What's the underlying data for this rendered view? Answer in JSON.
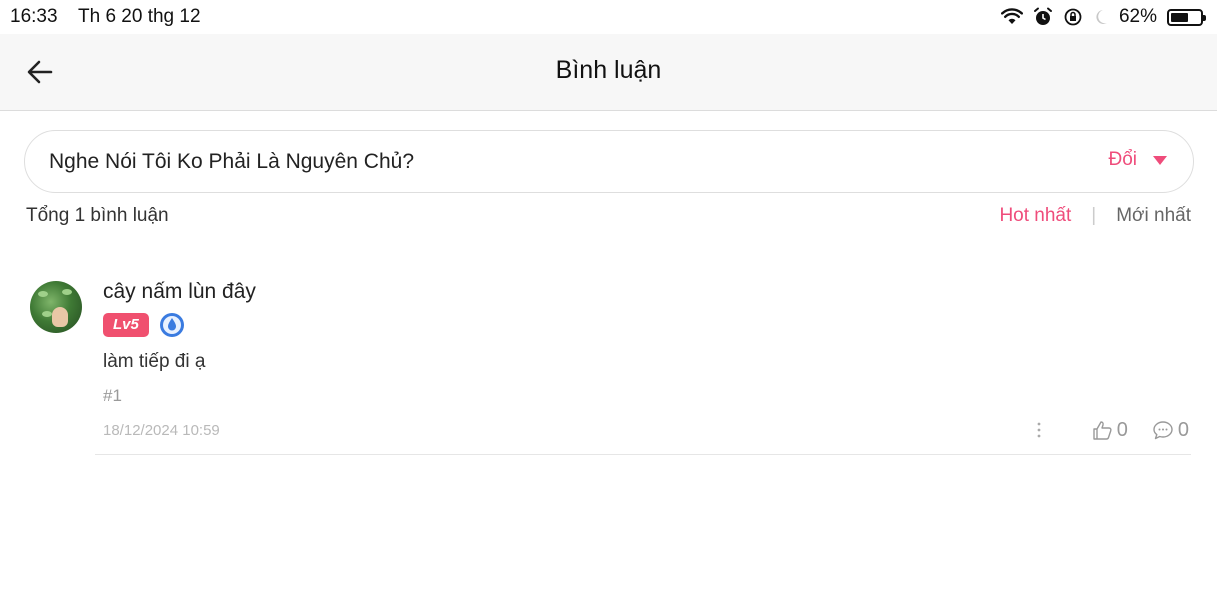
{
  "status_bar": {
    "time": "16:33",
    "date": "Th 6 20 thg 12",
    "battery_percent": "62%",
    "battery_level": 0.62
  },
  "header": {
    "title": "Bình luận",
    "back_icon": "arrow-left-icon"
  },
  "chapter_selector": {
    "title": "Nghe Nói Tôi Ko Phải Là Nguyên Chủ?",
    "change_label": "Đổi",
    "accent_color": "#ef4c7b"
  },
  "comments_header": {
    "count_label": "Tổng 1 bình luận",
    "sort_hot": "Hot nhất",
    "sort_separator": "|",
    "sort_new": "Mới nhất"
  },
  "comments": [
    {
      "username": "cây nấm lùn đây",
      "level": "Lv5",
      "text": "làm tiếp đi ạ",
      "floor": "#1",
      "timestamp": "18/12/2024 10:59",
      "likes": "0",
      "replies": "0"
    }
  ]
}
